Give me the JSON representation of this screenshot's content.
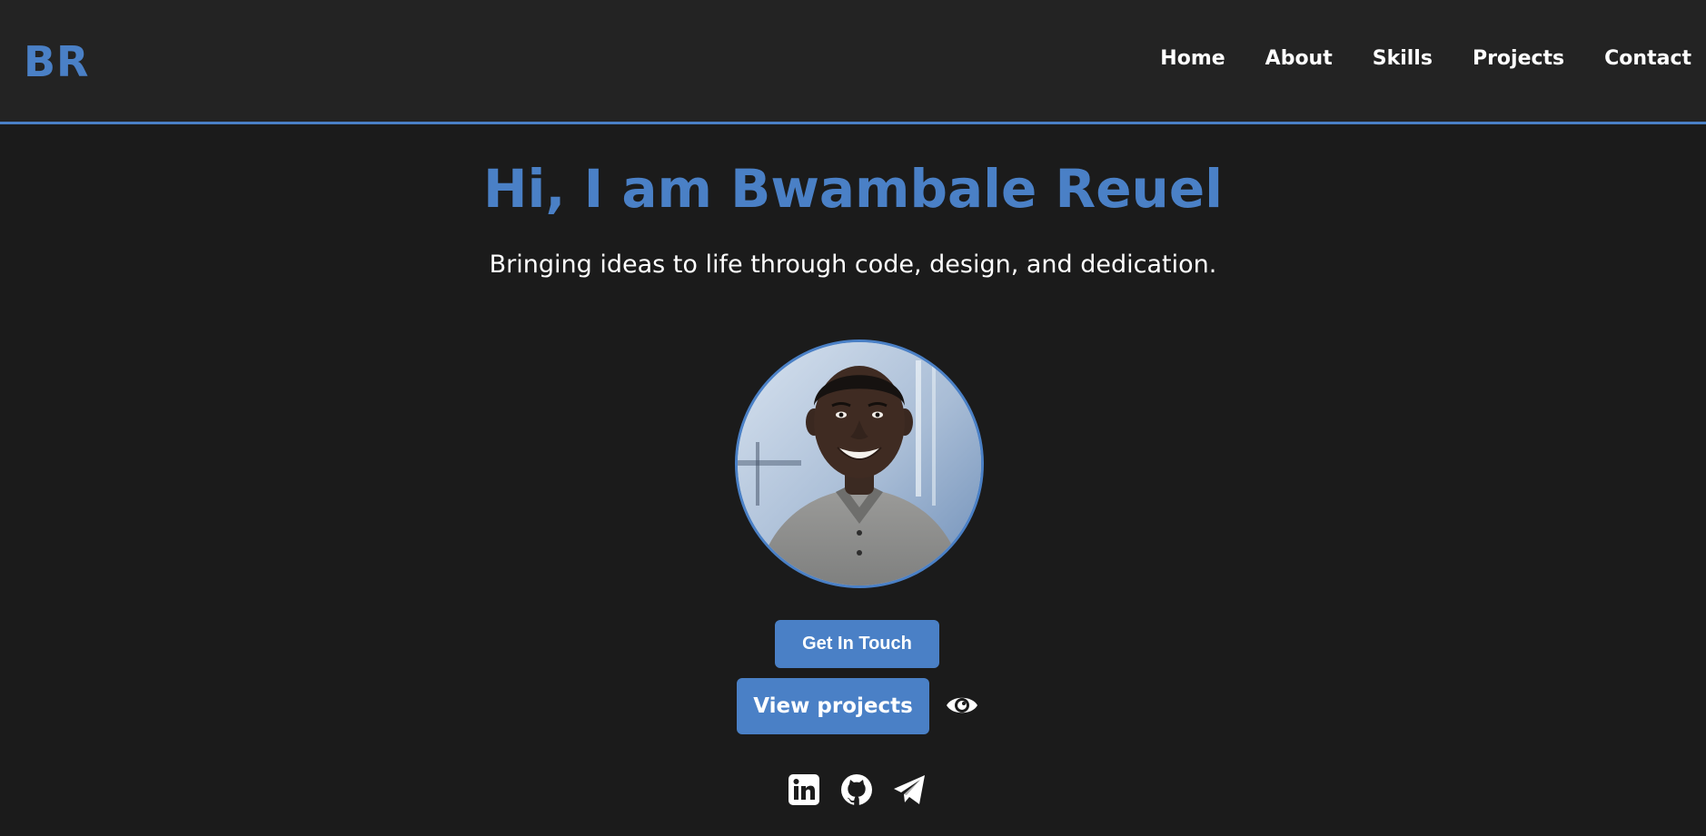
{
  "header": {
    "logo": "BR",
    "nav": [
      {
        "label": "Home"
      },
      {
        "label": "About"
      },
      {
        "label": "Skills"
      },
      {
        "label": "Projects"
      },
      {
        "label": "Contact"
      }
    ]
  },
  "hero": {
    "title": "Hi, I am Bwambale Reuel",
    "subtitle": "Bringing ideas to life through code, design, and dedication."
  },
  "avatar": {
    "alt": "Profile photo"
  },
  "actions": {
    "get_in_touch": "Get In Touch",
    "view_projects": "View projects",
    "view_icon": "eye-icon"
  },
  "social": [
    {
      "icon": "linkedin-icon"
    },
    {
      "icon": "github-icon"
    },
    {
      "icon": "telegram-icon"
    }
  ],
  "colors": {
    "accent": "#4a80c6",
    "background": "#1b1b1b",
    "header_background": "#232323",
    "text": "#ffffff"
  }
}
